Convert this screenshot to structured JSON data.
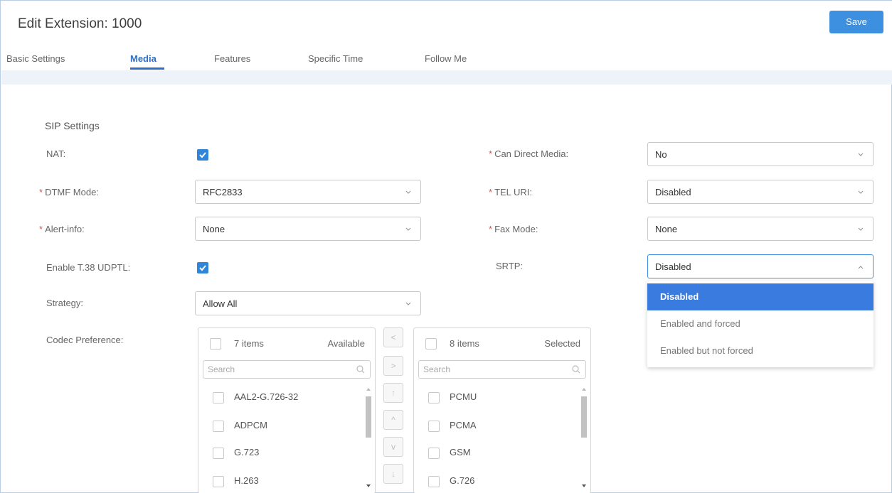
{
  "header": {
    "title": "Edit Extension: 1000",
    "save_label": "Save"
  },
  "tabs": [
    {
      "label": "Basic Settings",
      "active": false
    },
    {
      "label": "Media",
      "active": true
    },
    {
      "label": "Features",
      "active": false
    },
    {
      "label": "Specific Time",
      "active": false
    },
    {
      "label": "Follow Me",
      "active": false
    }
  ],
  "section": {
    "title": "SIP Settings"
  },
  "fields": {
    "nat": {
      "label": "NAT:",
      "checked": true
    },
    "dtmf_mode": {
      "label": "DTMF Mode:",
      "required": true,
      "value": "RFC2833"
    },
    "alert_info": {
      "label": "Alert-info:",
      "required": true,
      "value": "None"
    },
    "t38": {
      "label": "Enable T.38 UDPTL:",
      "checked": true
    },
    "strategy": {
      "label": "Strategy:",
      "value": "Allow All"
    },
    "codec_preference": {
      "label": "Codec Preference:"
    },
    "can_direct_media": {
      "label": "Can Direct Media:",
      "required": true,
      "value": "No"
    },
    "tel_uri": {
      "label": "TEL URI:",
      "required": true,
      "value": "Disabled"
    },
    "fax_mode": {
      "label": "Fax Mode:",
      "required": true,
      "value": "None"
    },
    "srtp": {
      "label": "SRTP:",
      "value": "Disabled",
      "open": true
    }
  },
  "srtp_options": [
    "Disabled",
    "Enabled and forced",
    "Enabled but not forced"
  ],
  "required_mark": "*",
  "codec": {
    "available": {
      "count": "7 items",
      "title": "Available",
      "search_placeholder": "Search",
      "items": [
        "AAL2-G.726-32",
        "ADPCM",
        "G.723",
        "H.263"
      ]
    },
    "selected": {
      "count": "8 items",
      "title": "Selected",
      "search_placeholder": "Search",
      "items": [
        "PCMU",
        "PCMA",
        "GSM",
        "G.726"
      ]
    },
    "transfer_buttons": [
      "<",
      ">",
      "↑",
      "^",
      "v",
      "↓"
    ]
  },
  "colors": {
    "accent": "#3d8fe0",
    "active_tab": "#2f6ec4",
    "selected_option": "#3a7be0",
    "required": "#e0504f"
  }
}
